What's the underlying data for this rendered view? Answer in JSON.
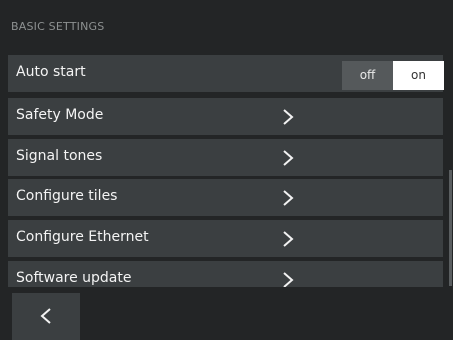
{
  "header": {
    "section_title": "BASIC SETTINGS"
  },
  "settings": {
    "auto_start": {
      "label": "Auto start",
      "toggle_off": "off",
      "toggle_on": "on",
      "selected": "on"
    },
    "items": [
      {
        "label": "Safety Mode",
        "icon": "chevron-right-icon"
      },
      {
        "label": "Signal tones",
        "icon": "chevron-right-icon"
      },
      {
        "label": "Configure tiles",
        "icon": "chevron-right-icon"
      },
      {
        "label": "Configure Ethernet",
        "icon": "chevron-right-icon"
      },
      {
        "label": "Software update",
        "icon": "chevron-right-icon"
      }
    ]
  },
  "footer": {
    "back_icon": "chevron-left-icon"
  },
  "colors": {
    "background": "#232526",
    "row": "#3b3f41",
    "toggle_selected": "#ffffff",
    "toggle_unselected": "#55595b"
  }
}
